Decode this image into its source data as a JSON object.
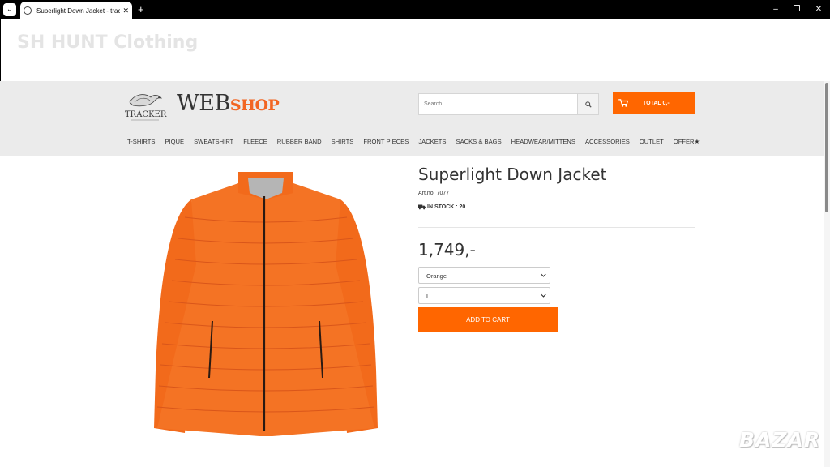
{
  "browser": {
    "tab_title": "Superlight Down Jacket - tracke",
    "tab_close": "✕",
    "new_tab": "+",
    "window_controls": [
      "–",
      "❐",
      "✕"
    ]
  },
  "page": {
    "ghost_title": "SH HUNT Clothing"
  },
  "header": {
    "logo_tracker": "TRACKER",
    "logo_web": "WEB",
    "logo_shop": "SHOP",
    "search_placeholder": "Search",
    "cart_label": "TOTAL 0,-",
    "nav": [
      "T-SHIRTS",
      "PIQUE",
      "SWEATSHIRT",
      "FLEECE",
      "RUBBER BAND",
      "SHIRTS",
      "FRONT PIECES",
      "JACKETS",
      "SACKS & BAGS",
      "HEADWEAR/MITTENS",
      "ACCESSORIES",
      "OUTLET",
      "OFFER"
    ]
  },
  "product": {
    "title": "Superlight Down Jacket",
    "art_no": "Art.no: 7077",
    "stock": "IN STOCK : 20",
    "price": "1,749,-",
    "color_option": "Orange",
    "size_option": "L",
    "add_to_cart": "ADD TO CART"
  },
  "watermark": "BAZAR",
  "colors": {
    "accent": "#ff6600",
    "jacket": "#f26a1b",
    "header_bg": "#ebebeb"
  }
}
